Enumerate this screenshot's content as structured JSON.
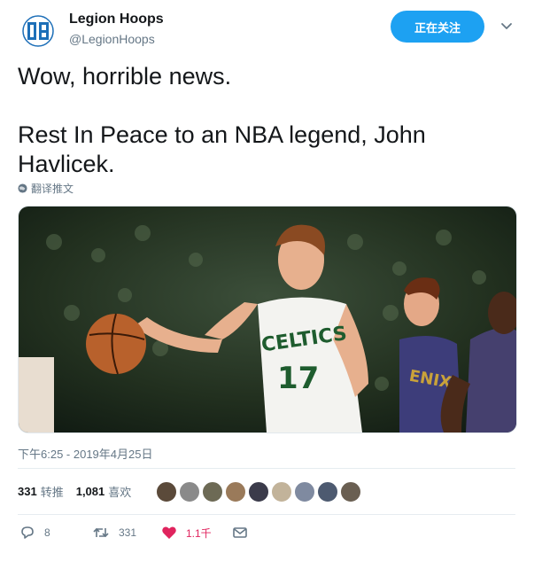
{
  "user": {
    "display_name": "Legion Hoops",
    "handle": "@LegionHoops",
    "avatar_icon": "legion-hoops-logo"
  },
  "follow_button": {
    "label": "正在关注"
  },
  "tweet": {
    "line1": "Wow, horrible news.",
    "line2": "Rest In Peace to an NBA legend, John Havlicek."
  },
  "translate_link": "翻译推文",
  "timestamp": "下午6:25 - 2019年4月25日",
  "stats": {
    "retweets_count": "331",
    "retweets_label": "转推",
    "likes_count": "1,081",
    "likes_label": "喜欢",
    "liker_avatars_count": 9
  },
  "actions": {
    "replies": "8",
    "retweets": "331",
    "likes": "1.1千"
  },
  "colors": {
    "accent": "#1da1f2",
    "like": "#e0245e",
    "muted": "#657786"
  }
}
